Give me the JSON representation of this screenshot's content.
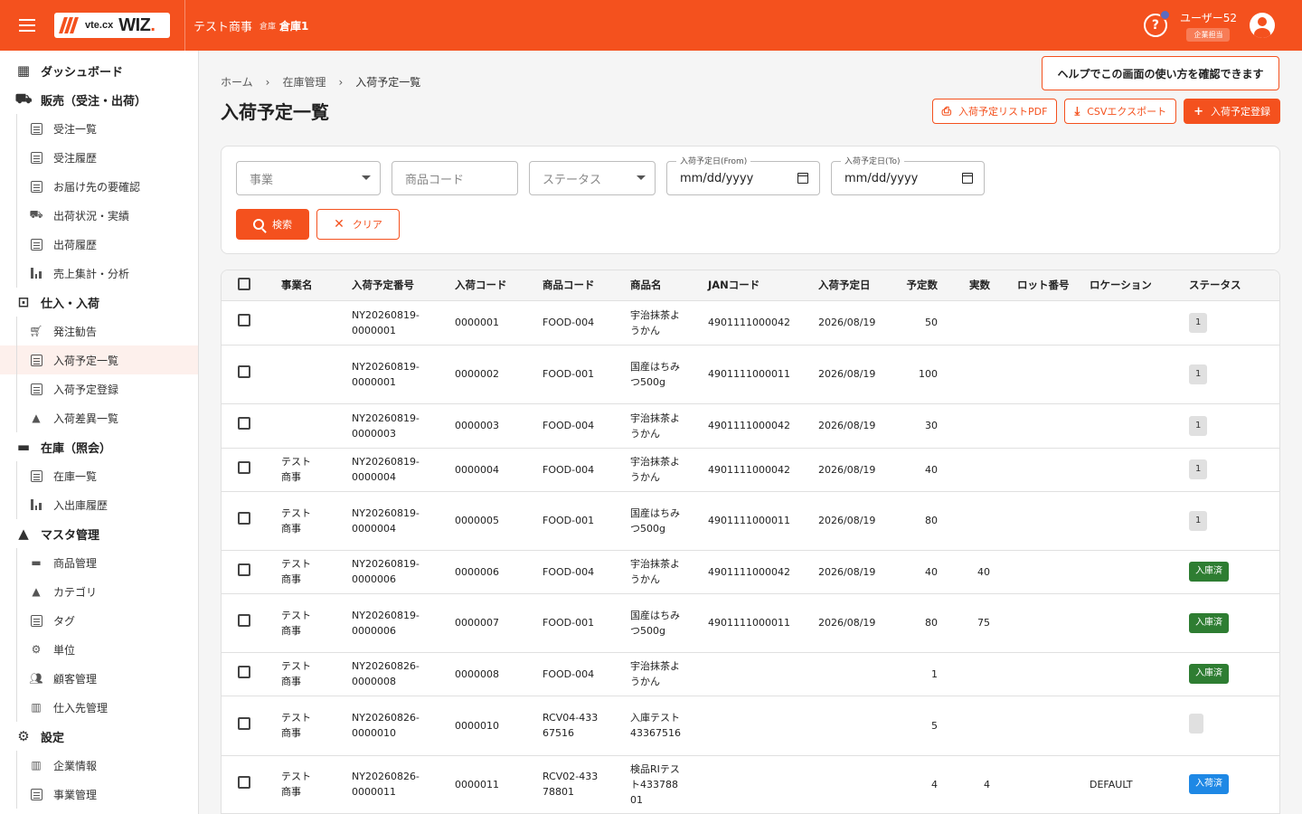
{
  "header": {
    "logo_text_small": "vte.cx",
    "logo_text_big": "WIZ",
    "company": "テスト商事",
    "warehouse_label": "倉庫",
    "warehouse_name": "倉庫1",
    "user_name": "ユーザー52",
    "user_role": "企業担当",
    "accent_color": "#f4511e"
  },
  "tooltip": {
    "text": "ヘルプでこの画面の使い方を確認できます"
  },
  "sidebar": {
    "dashboard": "ダッシュボード",
    "sales": {
      "label": "販売（受注・出荷）",
      "items": [
        "受注一覧",
        "受注履歴",
        "お届け先の要確認",
        "出荷状況・実績",
        "出荷履歴",
        "売上集計・分析"
      ]
    },
    "purchase": {
      "label": "仕入・入荷",
      "items": [
        "発注勧告",
        "入荷予定一覧",
        "入荷予定登録",
        "入荷差異一覧"
      ]
    },
    "stock": {
      "label": "在庫（照会）",
      "items": [
        "在庫一覧",
        "入出庫履歴"
      ]
    },
    "master": {
      "label": "マスタ管理",
      "items": [
        "商品管理",
        "カテゴリ",
        "タグ",
        "単位",
        "顧客管理",
        "仕入先管理"
      ]
    },
    "settings": {
      "label": "設定",
      "items": [
        "企業情報",
        "事業管理"
      ]
    }
  },
  "breadcrumb": [
    "ホーム",
    "在庫管理",
    "入荷予定一覧"
  ],
  "page_title": "入荷予定一覧",
  "actions": {
    "pdf": "入荷予定リストPDF",
    "csv": "CSVエクスポート",
    "register": "入荷予定登録"
  },
  "filters": {
    "business_placeholder": "事業",
    "product_code_placeholder": "商品コード",
    "status_placeholder": "ステータス",
    "date_from_label": "入荷予定日(From)",
    "date_from_value": "mm/dd/yyyy",
    "date_to_label": "入荷予定日(To)",
    "date_to_value": "mm/dd/yyyy",
    "search": "検索",
    "clear": "クリア"
  },
  "table": {
    "columns": [
      "事業名",
      "入荷予定番号",
      "入荷コード",
      "商品コード",
      "商品名",
      "JANコード",
      "入荷予定日",
      "予定数",
      "実数",
      "ロット番号",
      "ロケーション",
      "ステータス"
    ],
    "rows": [
      {
        "business": "",
        "plan_no": "NY20260819-0000001",
        "code": "0000001",
        "product_code": "FOOD-004",
        "name": "宇治抹茶ようかん",
        "jan": "4901111000042",
        "date": "2026/08/19",
        "planned": "50",
        "actual": "",
        "lot": "",
        "location": "",
        "status": "1",
        "status_type": "gray"
      },
      {
        "business": "",
        "plan_no": "NY20260819-0000001",
        "code": "0000002",
        "product_code": "FOOD-001",
        "name": "国産はちみつ500g",
        "jan": "4901111000011",
        "date": "2026/08/19",
        "planned": "100",
        "actual": "",
        "lot": "",
        "location": "",
        "status": "1",
        "status_type": "gray"
      },
      {
        "business": "",
        "plan_no": "NY20260819-0000003",
        "code": "0000003",
        "product_code": "FOOD-004",
        "name": "宇治抹茶ようかん",
        "jan": "4901111000042",
        "date": "2026/08/19",
        "planned": "30",
        "actual": "",
        "lot": "",
        "location": "",
        "status": "1",
        "status_type": "gray"
      },
      {
        "business": "テスト商事",
        "plan_no": "NY20260819-0000004",
        "code": "0000004",
        "product_code": "FOOD-004",
        "name": "宇治抹茶ようかん",
        "jan": "4901111000042",
        "date": "2026/08/19",
        "planned": "40",
        "actual": "",
        "lot": "",
        "location": "",
        "status": "1",
        "status_type": "gray"
      },
      {
        "business": "テスト商事",
        "plan_no": "NY20260819-0000004",
        "code": "0000005",
        "product_code": "FOOD-001",
        "name": "国産はちみつ500g",
        "jan": "4901111000011",
        "date": "2026/08/19",
        "planned": "80",
        "actual": "",
        "lot": "",
        "location": "",
        "status": "1",
        "status_type": "gray"
      },
      {
        "business": "テスト商事",
        "plan_no": "NY20260819-0000006",
        "code": "0000006",
        "product_code": "FOOD-004",
        "name": "宇治抹茶ようかん",
        "jan": "4901111000042",
        "date": "2026/08/19",
        "planned": "40",
        "actual": "40",
        "lot": "",
        "location": "",
        "status": "入庫済",
        "status_type": "green"
      },
      {
        "business": "テスト商事",
        "plan_no": "NY20260819-0000006",
        "code": "0000007",
        "product_code": "FOOD-001",
        "name": "国産はちみつ500g",
        "jan": "4901111000011",
        "date": "2026/08/19",
        "planned": "80",
        "actual": "75",
        "lot": "",
        "location": "",
        "status": "入庫済",
        "status_type": "green"
      },
      {
        "business": "テスト商事",
        "plan_no": "NY20260826-0000008",
        "code": "0000008",
        "product_code": "FOOD-004",
        "name": "宇治抹茶ようかん",
        "jan": "",
        "date": "",
        "planned": "1",
        "actual": "",
        "lot": "",
        "location": "",
        "status": "入庫済",
        "status_type": "green"
      },
      {
        "business": "テスト商事",
        "plan_no": "NY20260826-0000010",
        "code": "0000010",
        "product_code": "RCV04-43367516",
        "name": "入庫テスト43367516",
        "jan": "",
        "date": "",
        "planned": "5",
        "actual": "",
        "lot": "",
        "location": "",
        "status": "",
        "status_type": "empty"
      },
      {
        "business": "テスト商事",
        "plan_no": "NY20260826-0000011",
        "code": "0000011",
        "product_code": "RCV02-43378801",
        "name": "検品RIテスト43378801",
        "jan": "",
        "date": "",
        "planned": "4",
        "actual": "4",
        "lot": "",
        "location": "DEFAULT",
        "status": "入荷済",
        "status_type": "blue"
      }
    ]
  }
}
